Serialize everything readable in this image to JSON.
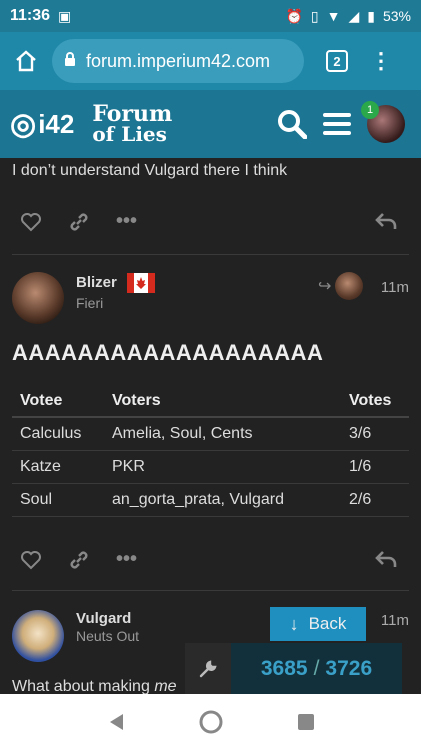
{
  "status_bar": {
    "time": "11:36",
    "battery": "53%"
  },
  "browser": {
    "url": "forum.imperium42.com",
    "tab_count": "2"
  },
  "forum_header": {
    "logo_i42": "i42",
    "logo_line1": "Forum",
    "logo_line2": "of Lies",
    "notification_count": "1"
  },
  "posts": {
    "prev_text": "I don’t understand Vulgard there I think",
    "post1": {
      "username": "Blizer",
      "user_title": "Fieri",
      "time": "11m",
      "body": "AAAAAAAAAAAAAAAAAAA",
      "table": {
        "headers": [
          "Votee",
          "Voters",
          "Votes"
        ],
        "rows": [
          [
            "Calculus",
            "Amelia, Soul, Cents",
            "3/6"
          ],
          [
            "Katze",
            "PKR",
            "1/6"
          ],
          [
            "Soul",
            "an_gorta_prata, Vulgard",
            "2/6"
          ]
        ]
      }
    },
    "post2": {
      "username": "Vulgard",
      "user_title": "Neuts Out",
      "time": "11m",
      "body_start": "What about making",
      "body_em": "me"
    }
  },
  "back_button": {
    "label": "Back"
  },
  "progress": {
    "current": "3685",
    "separator": "/",
    "total": "3726"
  },
  "colors": {
    "header": "#1b7593",
    "accent": "#1f8fbf",
    "background": "#222222"
  }
}
